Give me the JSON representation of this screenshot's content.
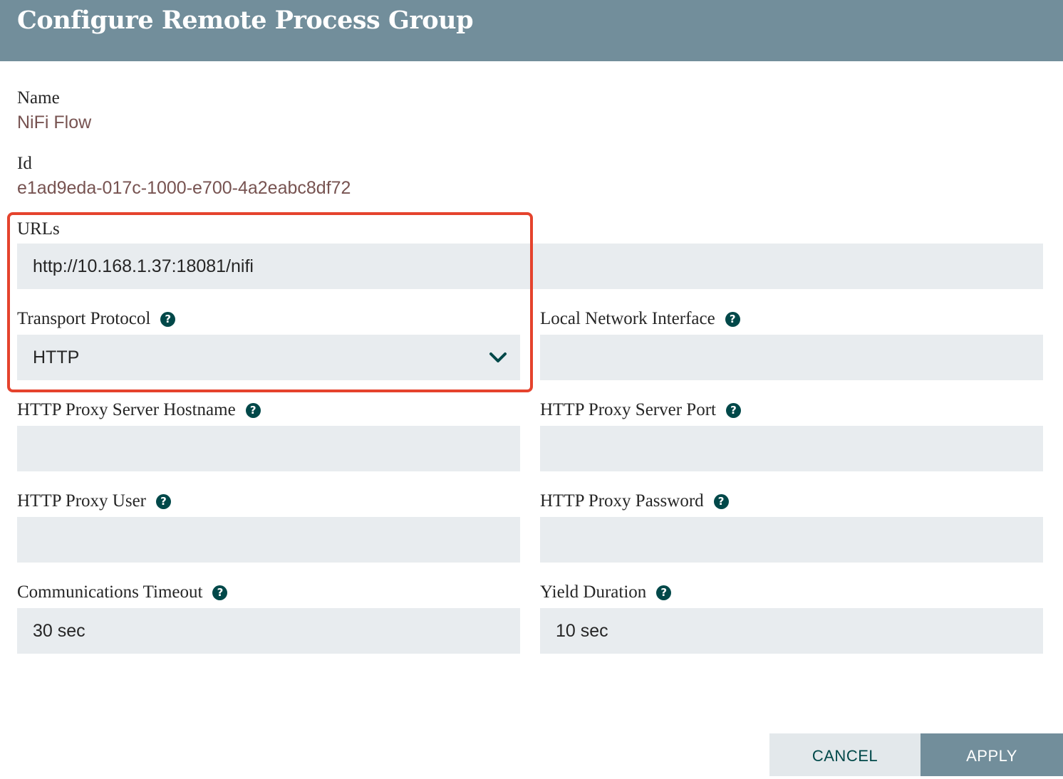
{
  "dialog": {
    "title": "Configure Remote Process Group"
  },
  "name": {
    "label": "Name",
    "value": "NiFi Flow"
  },
  "id": {
    "label": "Id",
    "value": "e1ad9eda-017c-1000-e700-4a2eabc8df72"
  },
  "urls": {
    "label": "URLs",
    "value": "http://10.168.1.37:18081/nifi"
  },
  "transport_protocol": {
    "label": "Transport Protocol",
    "value": "HTTP"
  },
  "local_network_interface": {
    "label": "Local Network Interface",
    "value": ""
  },
  "proxy_hostname": {
    "label": "HTTP Proxy Server Hostname",
    "value": ""
  },
  "proxy_port": {
    "label": "HTTP Proxy Server Port",
    "value": ""
  },
  "proxy_user": {
    "label": "HTTP Proxy User",
    "value": ""
  },
  "proxy_password": {
    "label": "HTTP Proxy Password",
    "value": ""
  },
  "communications_timeout": {
    "label": "Communications Timeout",
    "value": "30 sec"
  },
  "yield_duration": {
    "label": "Yield Duration",
    "value": "10 sec"
  },
  "buttons": {
    "cancel": "CANCEL",
    "apply": "APPLY"
  },
  "colors": {
    "header": "#728e9b",
    "value_text": "#775351",
    "field_bg": "#e8ecef",
    "icon": "#004849",
    "highlight": "#e5432d"
  },
  "icons": {
    "help": "question-circle-icon",
    "dropdown": "chevron-down-icon"
  }
}
